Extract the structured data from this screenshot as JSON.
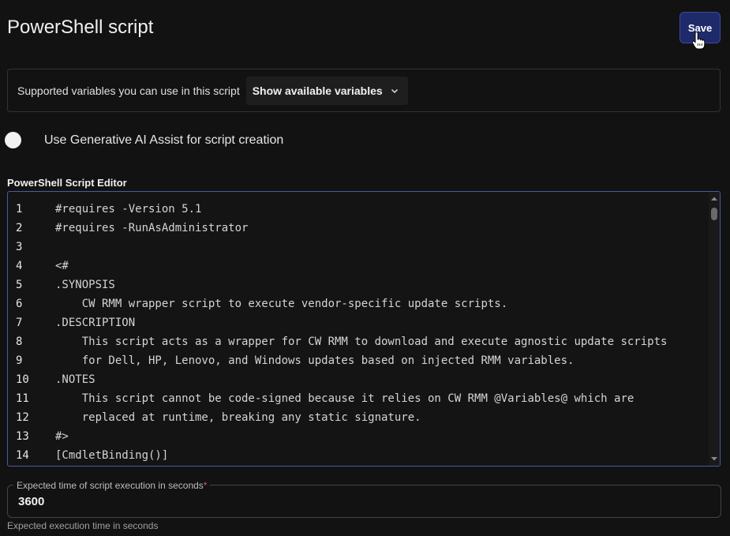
{
  "header": {
    "title": "PowerShell script",
    "save_label": "Save"
  },
  "variables": {
    "label": "Supported variables you can use in this script",
    "dropdown_label": "Show available variables"
  },
  "ai_assist": {
    "label": "Use Generative AI Assist for script creation",
    "enabled": false
  },
  "editor": {
    "label": "PowerShell Script Editor",
    "lines": [
      {
        "num": "1",
        "code": "#requires -Version 5.1"
      },
      {
        "num": "2",
        "code": "#requires -RunAsAdministrator"
      },
      {
        "num": "3",
        "code": ""
      },
      {
        "num": "4",
        "code": "<#"
      },
      {
        "num": "5",
        "code": ".SYNOPSIS"
      },
      {
        "num": "6",
        "code": "    CW RMM wrapper script to execute vendor-specific update scripts."
      },
      {
        "num": "7",
        "code": ".DESCRIPTION"
      },
      {
        "num": "8",
        "code": "    This script acts as a wrapper for CW RMM to download and execute agnostic update scripts"
      },
      {
        "num": "9",
        "code": "    for Dell, HP, Lenovo, and Windows updates based on injected RMM variables."
      },
      {
        "num": "10",
        "code": ".NOTES"
      },
      {
        "num": "11",
        "code": "    This script cannot be code-signed because it relies on CW RMM @Variables@ which are"
      },
      {
        "num": "12",
        "code": "    replaced at runtime, breaking any static signature."
      },
      {
        "num": "13",
        "code": "#>"
      },
      {
        "num": "14",
        "code": "[CmdletBinding()]"
      }
    ]
  },
  "execution_time": {
    "label": "Expected time of script execution in seconds",
    "required_mark": "*",
    "value": "3600",
    "helper": "Expected execution time in seconds"
  },
  "icons": {
    "cursor": "hand-pointer-icon",
    "dropdown": "chevron-down-icon"
  },
  "colors": {
    "background": "#121212",
    "accent": "#1f2a6b",
    "editor_border": "#4a5b9e",
    "required": "#e25555"
  }
}
